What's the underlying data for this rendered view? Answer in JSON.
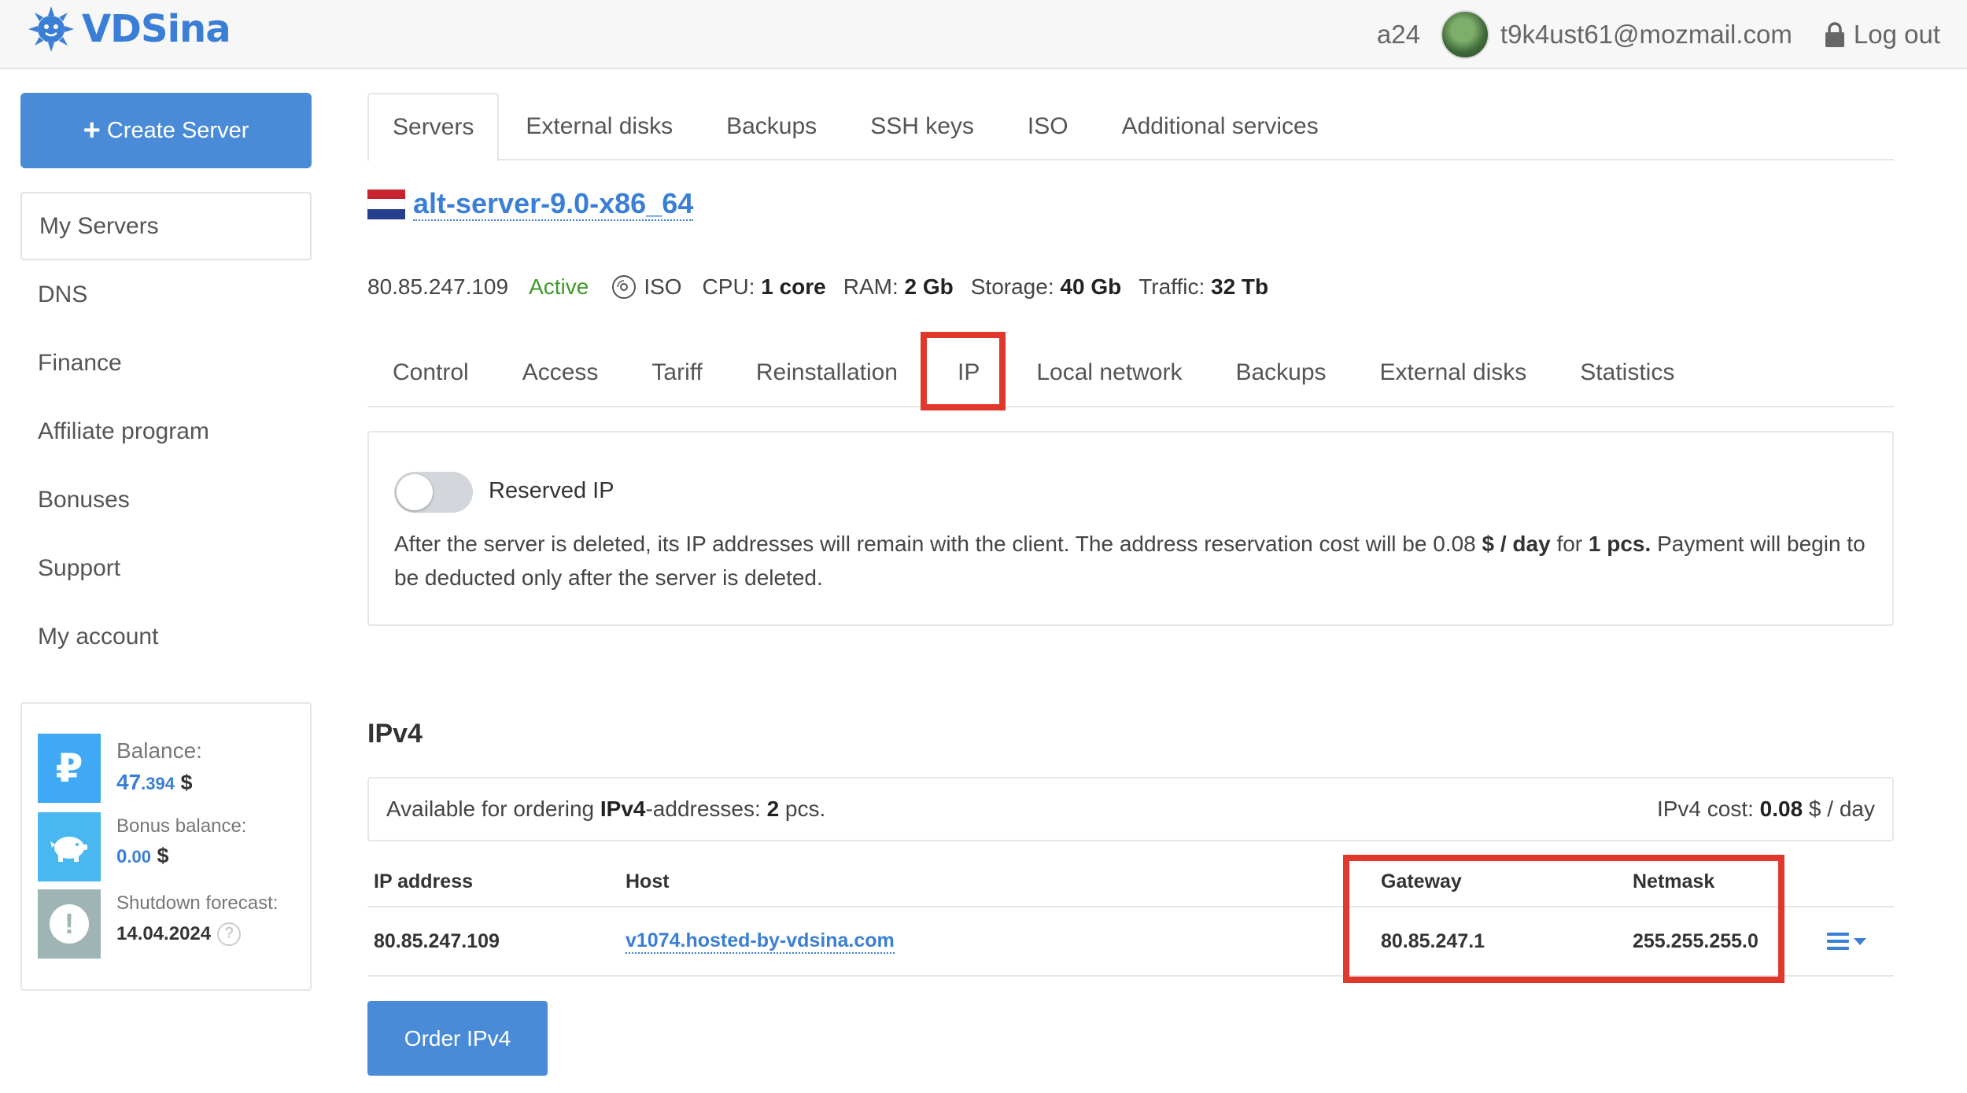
{
  "header": {
    "logo_text": "VDSina",
    "project": "a24",
    "email": "t9k4ust61@mozmail.com",
    "logout": "Log out",
    "brand_color": "#3a7fd5"
  },
  "sidebar": {
    "create_button": "Create Server",
    "items": [
      {
        "label": "My Servers"
      },
      {
        "label": "DNS"
      },
      {
        "label": "Finance"
      },
      {
        "label": "Affiliate program"
      },
      {
        "label": "Bonuses"
      },
      {
        "label": "Support"
      },
      {
        "label": "My account"
      }
    ],
    "balance": {
      "balance_label": "Balance:",
      "balance_main": "47",
      "balance_frac": ".394",
      "currency": "$",
      "bonus_label": "Bonus balance:",
      "bonus_main": "0",
      "bonus_frac": ".00",
      "forecast_label": "Shutdown forecast:",
      "forecast_date": "14.04.2024",
      "ruble_symbol": "₽",
      "warning_symbol": "!",
      "help_symbol": "?"
    }
  },
  "main": {
    "top_tabs": [
      {
        "label": "Servers"
      },
      {
        "label": "External disks"
      },
      {
        "label": "Backups"
      },
      {
        "label": "SSH keys"
      },
      {
        "label": "ISO"
      },
      {
        "label": "Additional services"
      }
    ],
    "server": {
      "name": "alt-server-9.0-x86_64",
      "ip": "80.85.247.109",
      "status": "Active",
      "iso": "ISO",
      "cpu_label": "CPU:",
      "cpu_value": "1 core",
      "ram_label": "RAM:",
      "ram_value": "2 Gb",
      "storage_label": "Storage:",
      "storage_value": "40 Gb",
      "traffic_label": "Traffic:",
      "traffic_value": "32 Tb"
    },
    "sub_tabs": [
      {
        "label": "Control"
      },
      {
        "label": "Access"
      },
      {
        "label": "Tariff"
      },
      {
        "label": "Reinstallation"
      },
      {
        "label": "IP"
      },
      {
        "label": "Local network"
      },
      {
        "label": "Backups"
      },
      {
        "label": "External disks"
      },
      {
        "label": "Statistics"
      }
    ],
    "reserved": {
      "toggle_label": "Reserved IP",
      "toggle_on": false,
      "desc_1": "After the server is deleted, its IP addresses will remain with the client. The address reservation cost will be 0.08 ",
      "desc_unit": "$ / day",
      "desc_2": " for ",
      "desc_qty": "1 pcs.",
      "desc_3": " Payment will begin to be deducted only after the server is deleted."
    },
    "ipv4": {
      "title": "IPv4",
      "avail_1": "Available for ordering ",
      "avail_bold": "IPv4",
      "avail_2": "-addresses: ",
      "avail_count": "2",
      "avail_3": " pcs.",
      "cost_label": "IPv4 cost: ",
      "cost_value": "0.08",
      "cost_unit": " $ / day",
      "columns": [
        "IP address",
        "Host",
        "Gateway",
        "Netmask"
      ],
      "rows": [
        {
          "ip": "80.85.247.109",
          "host": "v1074.hosted-by-vdsina.com",
          "gateway": "80.85.247.1",
          "netmask": "255.255.255.0"
        }
      ],
      "order_button": "Order IPv4"
    }
  },
  "colors": {
    "accent": "#4a8bd8",
    "link": "#3a7fd5",
    "active_status": "#3c9a28",
    "highlight": "#e0382a",
    "ruble_tile": "#3fa9f5",
    "piggy_tile": "#4ab8f0",
    "warning_tile": "#9fb5b5"
  }
}
